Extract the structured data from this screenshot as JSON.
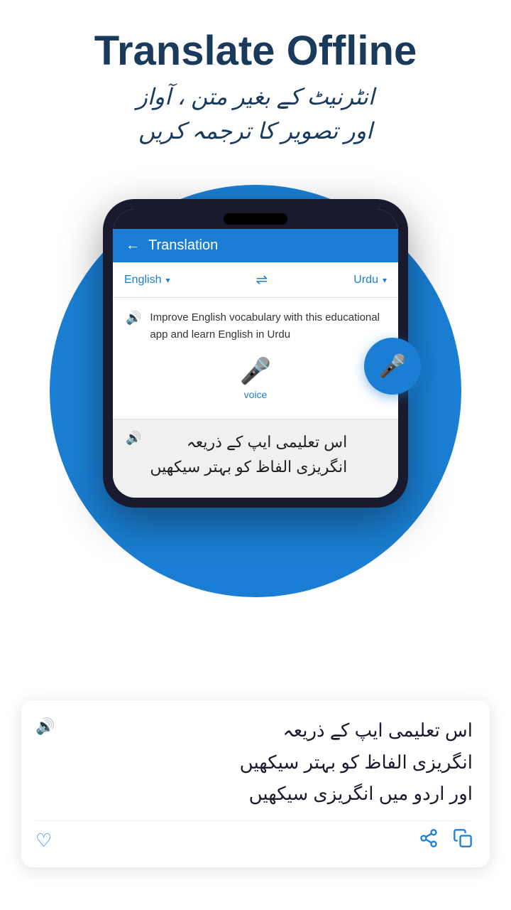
{
  "header": {
    "title_part1": "Translate",
    "title_part2": "Offline",
    "subtitle_line1": "انٹرنیٹ کے بغیر متن ، آواز",
    "subtitle_line2": "اور تصویر کا ترجمہ کریں"
  },
  "app": {
    "title": "Translation",
    "source_lang": "English",
    "target_lang": "Urdu",
    "source_text": "Improve English vocabulary with this educational app and learn English in Urdu",
    "voice_label": "voice",
    "translated_partial_text": "اس تعلیمی ایپ کے ذریعہ\nانگریزی الفاظ کو بہتر سیکھیں",
    "translated_full_text": "اس تعلیمی ایپ کے ذریعہ\nانگریزی الفاظ کو بہتر سیکھیں\nاور اردو میں انگریزی سیکھیں"
  },
  "icons": {
    "back": "←",
    "speaker": "🔊",
    "mic": "🎤",
    "swap": "⇌",
    "heart": "♡",
    "share": "⬆",
    "copy": "❐",
    "chevron_down": "▾"
  },
  "colors": {
    "primary": "#1a7fd4",
    "dark": "#1a3a5c",
    "bg": "#ffffff"
  }
}
